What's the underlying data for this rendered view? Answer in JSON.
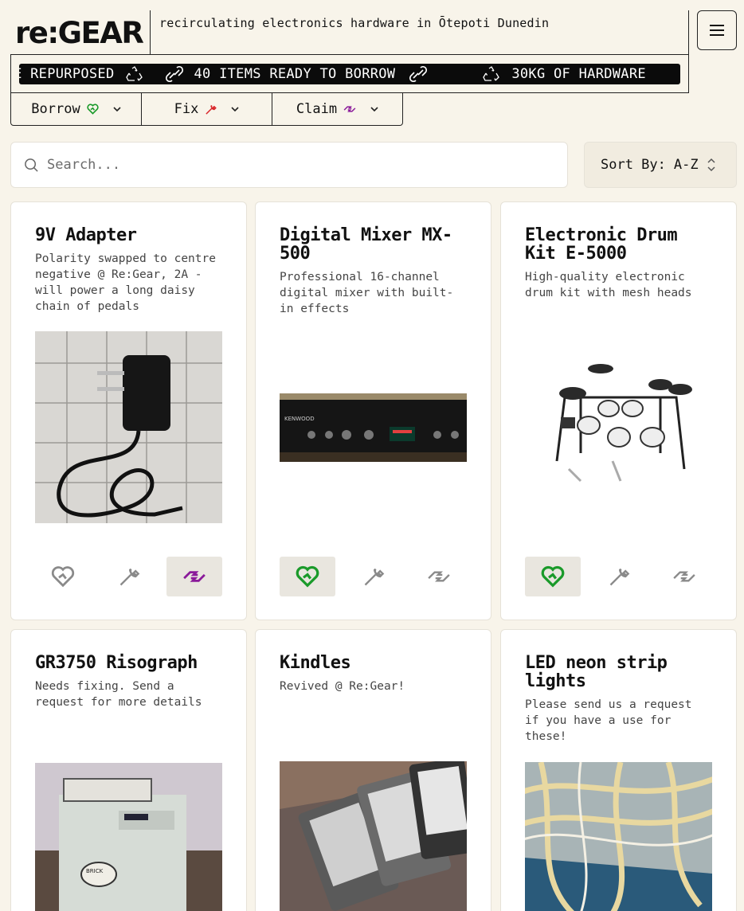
{
  "header": {
    "logo": "re:GEAR",
    "tagline": "recirculating electronics hardware in Ōtepoti Dunedin",
    "menu_icon": "hamburger-icon"
  },
  "ticker": {
    "segments": [
      {
        "text": "ARE REPURPOSED",
        "icon": "recycle-icon"
      },
      {
        "text": "40 ITEMS READY TO BORROW",
        "icon": "link-icon"
      },
      {
        "text": "30KG OF HARDWARE",
        "icon": "recycle-icon"
      }
    ]
  },
  "nav": {
    "borrow": "Borrow",
    "fix": "Fix",
    "claim": "Claim"
  },
  "search": {
    "placeholder": "Search..."
  },
  "sort": {
    "label": "Sort By:",
    "value": "A-Z"
  },
  "colors": {
    "background": "#f8f4ea",
    "borrow": "#1a9a2a",
    "fix": "#d9262a",
    "claim": "#8a1a9a",
    "icon_muted": "#8a8a8a"
  },
  "items": [
    {
      "title": "9V Adapter",
      "description": "Polarity swapped to centre negative @ Re:Gear, 2A - will power a long daisy chain of pedals",
      "image": "power-adapter-photo",
      "borrow": false,
      "fix": false,
      "claim": true
    },
    {
      "title": "Digital Mixer MX-500",
      "description": "Professional 16-channel digital mixer with built-in effects",
      "image": "audio-mixer-photo",
      "borrow": true,
      "fix": false,
      "claim": false
    },
    {
      "title": "Electronic Drum Kit E-5000",
      "description": "High-quality electronic drum kit with mesh heads",
      "image": "drum-kit-photo",
      "borrow": true,
      "fix": false,
      "claim": false
    },
    {
      "title": "GR3750 Risograph",
      "description": "Needs fixing. Send a request for more details",
      "image": "risograph-photo"
    },
    {
      "title": "Kindles",
      "description": "Revived @ Re:Gear!",
      "image": "kindles-photo"
    },
    {
      "title": "LED neon strip lights",
      "description": "Please send us a request if you have a use for these!",
      "image": "led-strip-photo"
    }
  ]
}
